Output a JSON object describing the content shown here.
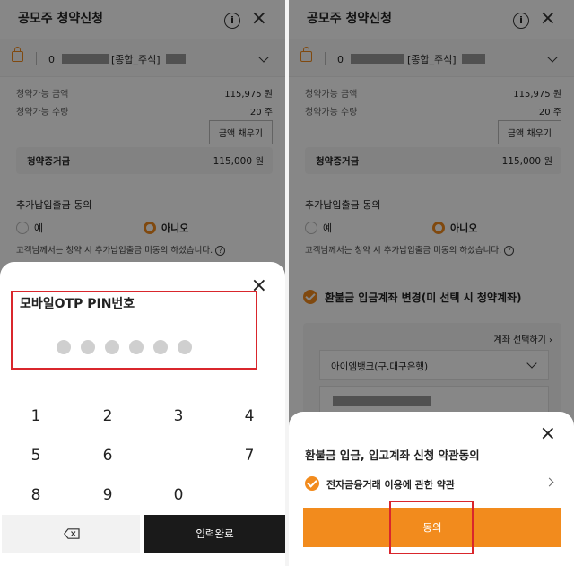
{
  "left_screen": {
    "header": {
      "title": "공모주 청약신청"
    },
    "account": {
      "number_visible": "0",
      "type_label": "[종합_주식]"
    },
    "rows": [
      {
        "label": "청약가능 금액",
        "value": "115,975 원"
      },
      {
        "label": "청약가능 수량",
        "value": "20 주"
      }
    ],
    "fill_button": "금액 채우기",
    "deposit": {
      "label": "청약증거금",
      "value": "115,000 원"
    },
    "extra_consent": {
      "title": "추가납입출금 동의",
      "options": [
        "예",
        "아니오"
      ],
      "selected": "아니오",
      "notice": "고객님께서는 청약 시 추가납입출금 미동의 하셨습니다."
    },
    "pin_sheet": {
      "title": "모바일OTP PIN번호",
      "pin_length": 6,
      "keys": [
        "1",
        "2",
        "3",
        "4",
        "5",
        "6",
        "7",
        "8",
        "9",
        "0"
      ],
      "submit_label": "입력완료"
    }
  },
  "right_screen": {
    "header": {
      "title": "공모주 청약신청"
    },
    "account": {
      "number_visible": "0",
      "type_label": "[종합_주식]"
    },
    "rows": [
      {
        "label": "청약가능 금액",
        "value": "115,975 원"
      },
      {
        "label": "청약가능 수량",
        "value": "20 주"
      }
    ],
    "fill_button": "금액 채우기",
    "deposit": {
      "label": "청약증거금",
      "value": "115,000 원"
    },
    "extra_consent": {
      "title": "추가납입출금 동의",
      "options": [
        "예",
        "아니오"
      ],
      "selected": "아니오",
      "notice": "고객님께서는 청약 시 추가납입출금 미동의 하셨습니다."
    },
    "refund": {
      "title": "환불금 입금계좌 변경(미 선택 시 청약계좌)",
      "select_account_link": "계좌 선택하기",
      "bank": "아이엠뱅크(구.대구은행)"
    },
    "agree_sheet": {
      "title": "환불금 입금, 입고계좌 신청 약관동의",
      "terms_item": "전자금융거래 이용에 관한 약관",
      "agree_button": "동의"
    }
  },
  "colors": {
    "accent": "#f28b1d",
    "highlight": "#d9262c",
    "dark_button": "#1a1a1a"
  }
}
